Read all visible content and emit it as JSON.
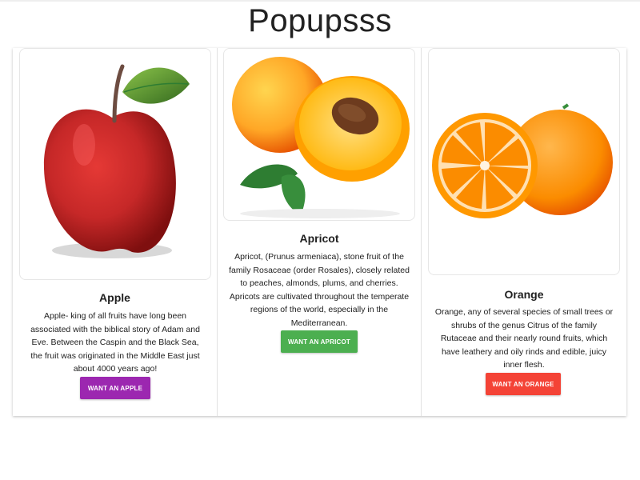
{
  "page": {
    "title": "Popupsss"
  },
  "colors": {
    "apple_button": "#9c27b0",
    "apricot_button": "#4caf50",
    "orange_button": "#f44336"
  },
  "cards": [
    {
      "title": "Apple",
      "image_icon": "apple-image",
      "text": "Apple- king of all fruits have long been associated with the biblical story of Adam and Eve. Between the Caspin and the Black Sea, the fruit was originated in the Middle East just about 4000 years ago!",
      "button_label": "WANT AN APPLE"
    },
    {
      "title": "Apricot",
      "image_icon": "apricot-image",
      "text": "Apricot, (Prunus armeniaca), stone fruit of the family Rosaceae (order Rosales), closely related to peaches, almonds, plums, and cherries. Apricots are cultivated throughout the temperate regions of the world, especially in the Mediterranean.",
      "button_label": "WANT AN APRICOT"
    },
    {
      "title": "Orange",
      "image_icon": "orange-image",
      "text": "Orange, any of several species of small trees or shrubs of the genus Citrus of the family Rutaceae and their nearly round fruits, which have leathery and oily rinds and edible, juicy inner flesh.",
      "button_label": "WANT AN ORANGE"
    }
  ]
}
